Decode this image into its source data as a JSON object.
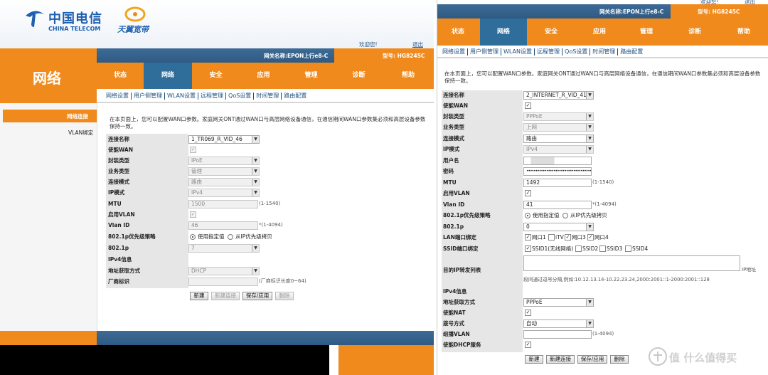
{
  "left": {
    "logo": {
      "brand_cn": "中国电信",
      "brand_en": "CHINA TELECOM",
      "sub_brand": "天翼宽带"
    },
    "gateway_name": "网关名称:EPON上行e8-C",
    "model": "型号: HG8245C",
    "welcome": "欢迎您!",
    "logout": "退出",
    "section_title": "网络",
    "nav": [
      "状态",
      "网络",
      "安全",
      "应用",
      "管理",
      "诊断",
      "帮助"
    ],
    "active_nav": 1,
    "subnav": [
      "网络设置",
      "用户侧管理",
      "WLAN设置",
      "远程管理",
      "QoS设置",
      "时间管理",
      "路由配置"
    ],
    "sidebar": [
      "网络连接",
      "VLAN绑定"
    ],
    "intro": "在本页面上，您可以配置WAN口参数。家庭网关ONT通过WAN口与高层网络设备通信，在通信期间WAN口参数集必须和高层设备参数保持一致。",
    "rows": [
      {
        "label": "连接名称",
        "value": "1_TR069_R_VID_46"
      },
      {
        "label": "使能WAN",
        "value": "✓"
      },
      {
        "label": "封装类型",
        "value": "IPoE"
      },
      {
        "label": "业务类型",
        "value": "管理"
      },
      {
        "label": "连接模式",
        "value": "路由"
      },
      {
        "label": "IP模式",
        "value": "IPv4"
      },
      {
        "label": "MTU",
        "value": "1500",
        "hint": "(1-1540)"
      },
      {
        "label": "启用VLAN",
        "value": "✓"
      },
      {
        "label": "Vlan ID",
        "value": "46",
        "hint": "*(1-4094)"
      },
      {
        "label": "802.1p优先级策略",
        "opt1": "使用指定值",
        "opt2": "从IP优先级拷贝"
      },
      {
        "label": "802.1p",
        "value": "7"
      },
      {
        "label": "IPv4信息"
      },
      {
        "label": "地址获取方式",
        "value": "DHCP"
      },
      {
        "label": "厂商标识",
        "hint": "(厂商标识长度0~64)"
      }
    ],
    "buttons": [
      "新建",
      "新建连接",
      "保存/应用",
      "删除"
    ]
  },
  "right": {
    "gateway_name": "网关名称:EPON上行e8-C",
    "model": "型号: HG8245C",
    "welcome": "欢迎您!",
    "logout": "退出",
    "nav": [
      "状态",
      "网络",
      "安全",
      "应用",
      "管理",
      "诊断",
      "帮助"
    ],
    "active_nav": 1,
    "subnav": [
      "网络设置",
      "用户侧管理",
      "WLAN设置",
      "远程管理",
      "QoS设置",
      "时间管理",
      "路由配置"
    ],
    "intro": "在本页面上，您可以配置WAN口参数。家庭网关ONT通过WAN口与高层网络设备通信，在通信期间WAN口参数集必须和高层设备参数保持一致。",
    "rows": [
      {
        "label": "连接名称",
        "value": "2_INTERNET_R_VID_41"
      },
      {
        "label": "使能WAN",
        "value": "✓"
      },
      {
        "label": "封装类型",
        "value": "PPPoE"
      },
      {
        "label": "业务类型",
        "value": "上网"
      },
      {
        "label": "连接模式",
        "value": "路由"
      },
      {
        "label": "IP模式",
        "value": "IPv4"
      },
      {
        "label": "用户名",
        "value": ""
      },
      {
        "label": "密码",
        "value": "•••••••••••••••••••••••••••••••••••••••••••••"
      },
      {
        "label": "MTU",
        "value": "1492",
        "hint": "(1-1540)"
      },
      {
        "label": "启用VLAN",
        "value": "✓"
      },
      {
        "label": "Vlan ID",
        "value": "41",
        "hint": "*(1-4094)"
      },
      {
        "label": "802.1p优先级策略",
        "opt1": "使用指定值",
        "opt2": "从IP优先级拷贝"
      },
      {
        "label": "802.1p",
        "value": "0"
      },
      {
        "label": "LAN端口绑定",
        "ports": [
          "网口1",
          "iTV",
          "网口3",
          "网口4"
        ]
      },
      {
        "label": "SSID端口绑定",
        "ssids": [
          "SSID1(无线网络)",
          "SSID2",
          "SSID3",
          "SSID4"
        ]
      },
      {
        "label": "目的IP转发列表",
        "hint": "IP地址",
        "example": "段间通过逗号分隔,例如:10.12.13.14-10.22.23.24,2000:2001::1-2000:2001::128"
      },
      {
        "label": "IPv4信息"
      },
      {
        "label": "地址获取方式",
        "value": "PPPoE"
      },
      {
        "label": "使能NAT",
        "value": "✓"
      },
      {
        "label": "拨号方式",
        "value": "自动"
      },
      {
        "label": "组播VLAN",
        "hint": "(1-4094)"
      },
      {
        "label": "使能DHCP服务",
        "value": "✓"
      }
    ],
    "buttons": [
      "新建",
      "新建连接",
      "保存/应用",
      "删除"
    ]
  },
  "watermark": "值 什么值得买",
  "colors": {
    "orange": "#f08a1c",
    "blue": "#2f5a83",
    "link": "#1d4f80"
  }
}
